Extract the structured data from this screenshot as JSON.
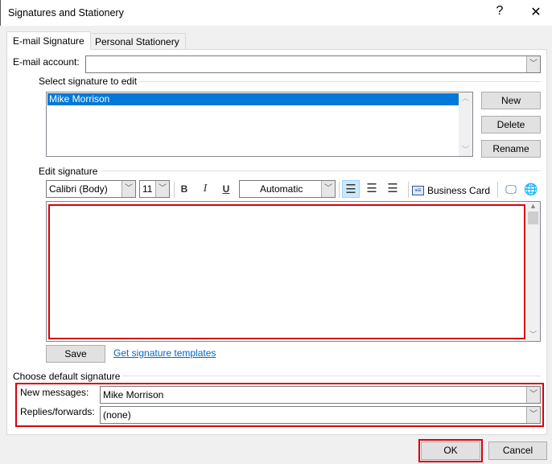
{
  "window": {
    "title": "Signatures and Stationery",
    "help": "?",
    "close": "✕"
  },
  "tabs": [
    {
      "label": "E-mail Signature",
      "active": true
    },
    {
      "label": "Personal Stationery",
      "active": false
    }
  ],
  "email_account": {
    "label": "E-mail account:",
    "value": ""
  },
  "select_signature": {
    "label": "Select signature to edit",
    "items": [
      {
        "name": "Mike Morrison",
        "selected": true
      }
    ]
  },
  "sig_buttons": {
    "new": "New",
    "delete": "Delete",
    "rename": "Rename"
  },
  "edit_signature": {
    "label": "Edit signature",
    "font": "Calibri (Body)",
    "size": "11",
    "bold": "B",
    "italic": "I",
    "underline": "U",
    "color": "Automatic",
    "business_card": "Business Card",
    "content": ""
  },
  "save": "Save",
  "templates_link": "Get signature templates",
  "default_signature": {
    "label": "Choose default signature",
    "new_messages_label": "New messages:",
    "new_messages_value": "Mike Morrison",
    "replies_label": "Replies/forwards:",
    "replies_value": "(none)"
  },
  "footer": {
    "ok": "OK",
    "cancel": "Cancel"
  },
  "colors": {
    "selection": "#0078d7",
    "highlight_border": "#d9000d",
    "link": "#0066cc",
    "align_active": "#cce8ff"
  }
}
